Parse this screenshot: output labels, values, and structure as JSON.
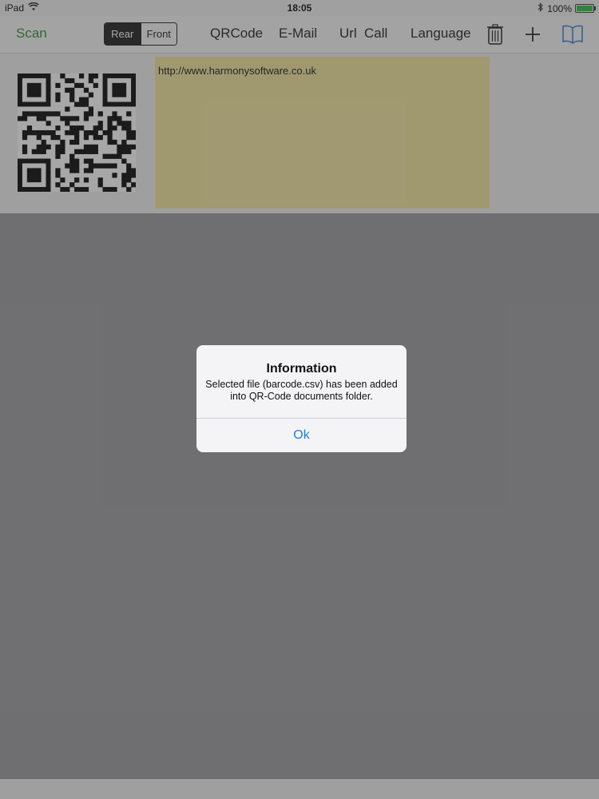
{
  "status_bar": {
    "device": "iPad",
    "time": "18:05",
    "battery": "100%",
    "battery_level": 1.0,
    "icons": [
      "wifi-icon",
      "bluetooth-icon",
      "battery-icon"
    ]
  },
  "toolbar": {
    "scan_label": "Scan",
    "camera_segment": {
      "options": [
        "Rear",
        "Front"
      ],
      "selected": "Rear"
    },
    "qrcode_label": "QRCode",
    "email_label": "E-Mail",
    "url_label": "Url",
    "call_label": "Call",
    "language_label": "Language",
    "icons": [
      "trash-icon",
      "plus-icon",
      "book-icon"
    ]
  },
  "content": {
    "text_value": "http://www.harmonysoftware.co.uk"
  },
  "alert": {
    "title": "Information",
    "message": "Selected file (barcode.csv) has been added into QR-Code documents folder.",
    "ok_label": "Ok"
  },
  "colors": {
    "scan_green": "#2f8a2f",
    "link_blue": "#1a7fd8",
    "textbox_yellow": "#f3e69a",
    "battery_green": "#2bbf3a",
    "book_icon_blue": "#3d7fd1"
  }
}
